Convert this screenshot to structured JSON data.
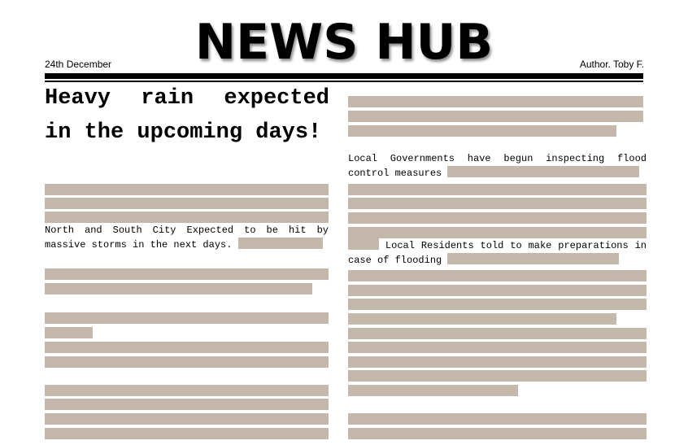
{
  "masthead": {
    "title": "NEWS HUB"
  },
  "header": {
    "date": "24th December",
    "author": "Author. Toby F."
  },
  "article": {
    "headline": "Heavy rain expected in the upcoming days!",
    "left_paragraph": "North and South City Expected to be hit by massive storms in the next days.",
    "right_paragraph_1": "Local Governments have begun inspecting flood control measures",
    "right_paragraph_2": "Local Residents told to make preparations in case of flooding"
  },
  "colors": {
    "placeholder_bar": "#c4b8ad",
    "text": "#000000",
    "background": "#ffffff"
  }
}
